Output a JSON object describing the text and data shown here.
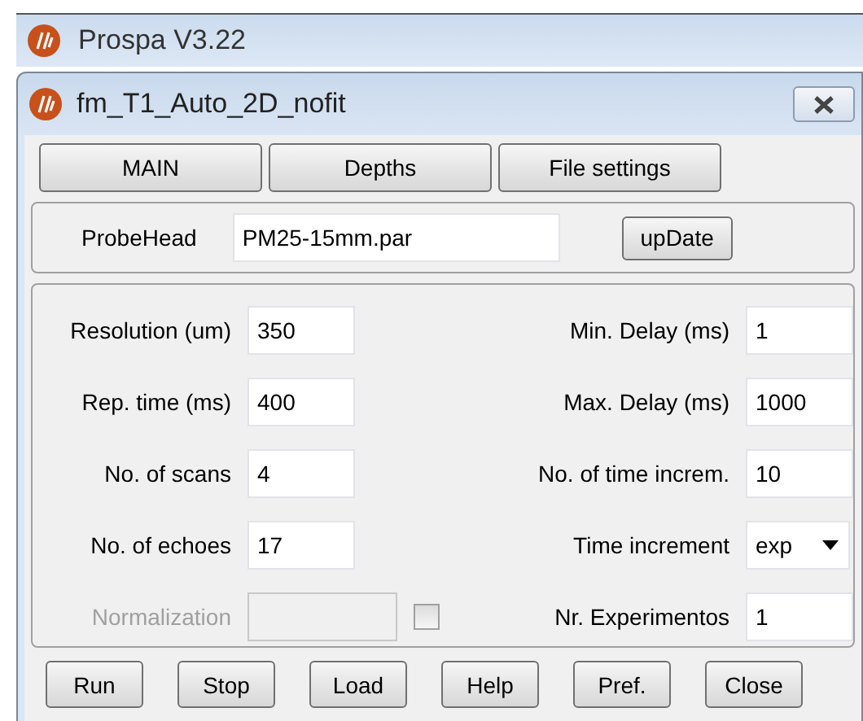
{
  "app_window": {
    "title": "Prospa V3.22"
  },
  "dialog": {
    "title": "fm_T1_Auto_2D_nofit"
  },
  "top_buttons": [
    "MAIN",
    "Depths",
    "File settings"
  ],
  "probe_head": {
    "label": "ProbeHead",
    "value": "PM25-15mm.par",
    "button": "upDate"
  },
  "parameter_rows": [
    {
      "left": {
        "kind": "text",
        "label": "Resolution (um)",
        "value": "350",
        "disabled": false
      },
      "right": {
        "kind": "text",
        "label": "Min. Delay (ms)",
        "value": "1"
      }
    },
    {
      "left": {
        "kind": "text",
        "label": "Rep. time (ms)",
        "value": "400",
        "disabled": false
      },
      "right": {
        "kind": "text",
        "label": "Max. Delay (ms)",
        "value": "1000"
      }
    },
    {
      "left": {
        "kind": "text",
        "label": "No. of scans",
        "value": "4",
        "disabled": false
      },
      "right": {
        "kind": "text",
        "label": "No. of time increm.",
        "value": "10"
      }
    },
    {
      "left": {
        "kind": "text",
        "label": "No. of echoes",
        "value": "17",
        "disabled": false
      },
      "right": {
        "kind": "dropdown",
        "label": "Time increment",
        "value": "exp"
      }
    },
    {
      "left": {
        "kind": "text_check",
        "label": "Normalization",
        "disabled": true,
        "checked": false
      },
      "right": {
        "kind": "text",
        "label": "Nr. Experimentos",
        "value": "1"
      }
    }
  ],
  "buttons": [
    "Run",
    "Stop",
    "Load",
    "Help",
    "Pref.",
    "Close"
  ]
}
